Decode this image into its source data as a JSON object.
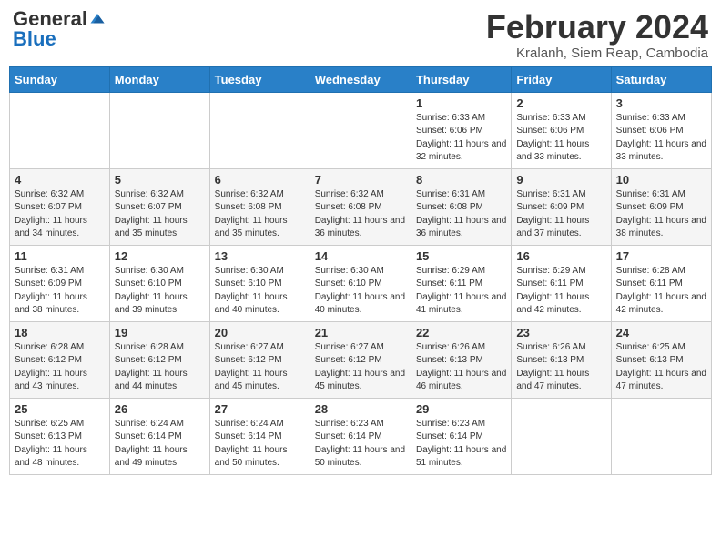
{
  "header": {
    "logo_general": "General",
    "logo_blue": "Blue",
    "month_title": "February 2024",
    "subtitle": "Kralanh, Siem Reap, Cambodia"
  },
  "days_of_week": [
    "Sunday",
    "Monday",
    "Tuesday",
    "Wednesday",
    "Thursday",
    "Friday",
    "Saturday"
  ],
  "weeks": [
    [
      {
        "num": "",
        "info": ""
      },
      {
        "num": "",
        "info": ""
      },
      {
        "num": "",
        "info": ""
      },
      {
        "num": "",
        "info": ""
      },
      {
        "num": "1",
        "info": "Sunrise: 6:33 AM\nSunset: 6:06 PM\nDaylight: 11 hours and 32 minutes."
      },
      {
        "num": "2",
        "info": "Sunrise: 6:33 AM\nSunset: 6:06 PM\nDaylight: 11 hours and 33 minutes."
      },
      {
        "num": "3",
        "info": "Sunrise: 6:33 AM\nSunset: 6:06 PM\nDaylight: 11 hours and 33 minutes."
      }
    ],
    [
      {
        "num": "4",
        "info": "Sunrise: 6:32 AM\nSunset: 6:07 PM\nDaylight: 11 hours and 34 minutes."
      },
      {
        "num": "5",
        "info": "Sunrise: 6:32 AM\nSunset: 6:07 PM\nDaylight: 11 hours and 35 minutes."
      },
      {
        "num": "6",
        "info": "Sunrise: 6:32 AM\nSunset: 6:08 PM\nDaylight: 11 hours and 35 minutes."
      },
      {
        "num": "7",
        "info": "Sunrise: 6:32 AM\nSunset: 6:08 PM\nDaylight: 11 hours and 36 minutes."
      },
      {
        "num": "8",
        "info": "Sunrise: 6:31 AM\nSunset: 6:08 PM\nDaylight: 11 hours and 36 minutes."
      },
      {
        "num": "9",
        "info": "Sunrise: 6:31 AM\nSunset: 6:09 PM\nDaylight: 11 hours and 37 minutes."
      },
      {
        "num": "10",
        "info": "Sunrise: 6:31 AM\nSunset: 6:09 PM\nDaylight: 11 hours and 38 minutes."
      }
    ],
    [
      {
        "num": "11",
        "info": "Sunrise: 6:31 AM\nSunset: 6:09 PM\nDaylight: 11 hours and 38 minutes."
      },
      {
        "num": "12",
        "info": "Sunrise: 6:30 AM\nSunset: 6:10 PM\nDaylight: 11 hours and 39 minutes."
      },
      {
        "num": "13",
        "info": "Sunrise: 6:30 AM\nSunset: 6:10 PM\nDaylight: 11 hours and 40 minutes."
      },
      {
        "num": "14",
        "info": "Sunrise: 6:30 AM\nSunset: 6:10 PM\nDaylight: 11 hours and 40 minutes."
      },
      {
        "num": "15",
        "info": "Sunrise: 6:29 AM\nSunset: 6:11 PM\nDaylight: 11 hours and 41 minutes."
      },
      {
        "num": "16",
        "info": "Sunrise: 6:29 AM\nSunset: 6:11 PM\nDaylight: 11 hours and 42 minutes."
      },
      {
        "num": "17",
        "info": "Sunrise: 6:28 AM\nSunset: 6:11 PM\nDaylight: 11 hours and 42 minutes."
      }
    ],
    [
      {
        "num": "18",
        "info": "Sunrise: 6:28 AM\nSunset: 6:12 PM\nDaylight: 11 hours and 43 minutes."
      },
      {
        "num": "19",
        "info": "Sunrise: 6:28 AM\nSunset: 6:12 PM\nDaylight: 11 hours and 44 minutes."
      },
      {
        "num": "20",
        "info": "Sunrise: 6:27 AM\nSunset: 6:12 PM\nDaylight: 11 hours and 45 minutes."
      },
      {
        "num": "21",
        "info": "Sunrise: 6:27 AM\nSunset: 6:12 PM\nDaylight: 11 hours and 45 minutes."
      },
      {
        "num": "22",
        "info": "Sunrise: 6:26 AM\nSunset: 6:13 PM\nDaylight: 11 hours and 46 minutes."
      },
      {
        "num": "23",
        "info": "Sunrise: 6:26 AM\nSunset: 6:13 PM\nDaylight: 11 hours and 47 minutes."
      },
      {
        "num": "24",
        "info": "Sunrise: 6:25 AM\nSunset: 6:13 PM\nDaylight: 11 hours and 47 minutes."
      }
    ],
    [
      {
        "num": "25",
        "info": "Sunrise: 6:25 AM\nSunset: 6:13 PM\nDaylight: 11 hours and 48 minutes."
      },
      {
        "num": "26",
        "info": "Sunrise: 6:24 AM\nSunset: 6:14 PM\nDaylight: 11 hours and 49 minutes."
      },
      {
        "num": "27",
        "info": "Sunrise: 6:24 AM\nSunset: 6:14 PM\nDaylight: 11 hours and 50 minutes."
      },
      {
        "num": "28",
        "info": "Sunrise: 6:23 AM\nSunset: 6:14 PM\nDaylight: 11 hours and 50 minutes."
      },
      {
        "num": "29",
        "info": "Sunrise: 6:23 AM\nSunset: 6:14 PM\nDaylight: 11 hours and 51 minutes."
      },
      {
        "num": "",
        "info": ""
      },
      {
        "num": "",
        "info": ""
      }
    ]
  ]
}
